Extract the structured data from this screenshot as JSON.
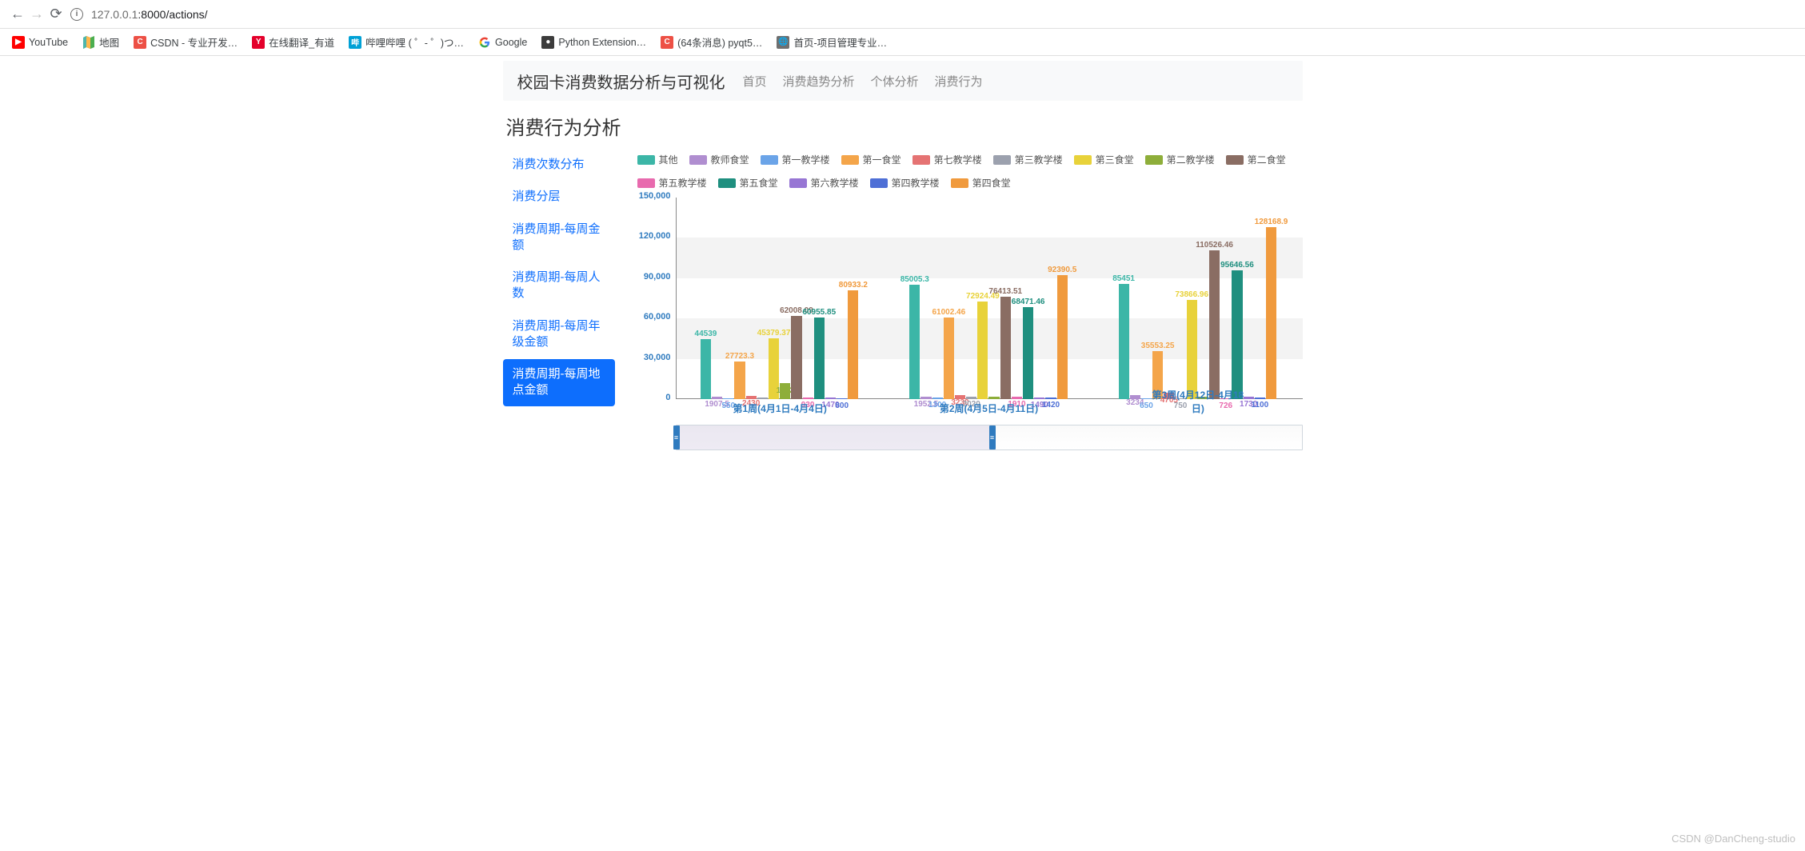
{
  "browser": {
    "url_host": "127.0.0.1",
    "url_port": ":8000",
    "url_path": "/actions/"
  },
  "bookmarks": [
    {
      "label": "YouTube",
      "bg": "#ff0000",
      "txt": "▶"
    },
    {
      "label": "地图",
      "bg": "",
      "txt": "",
      "icon": "map"
    },
    {
      "label": "CSDN - 专业开发…",
      "bg": "#ed5045",
      "txt": "C"
    },
    {
      "label": "在线翻译_有道",
      "bg": "#e4002b",
      "txt": "Y"
    },
    {
      "label": "哔哩哔哩 ( ゜- ゜)つ…",
      "bg": "#00a1d6",
      "txt": "哔"
    },
    {
      "label": "Google",
      "bg": "#ffffff",
      "txt": "G",
      "icon": "google"
    },
    {
      "label": "Python Extension…",
      "bg": "#3c3c3c",
      "txt": "●"
    },
    {
      "label": "(64条消息) pyqt5…",
      "bg": "#ed5045",
      "txt": "C"
    },
    {
      "label": "首页-项目管理专业…",
      "bg": "#6f6f6f",
      "txt": "🌐"
    }
  ],
  "header": {
    "brand": "校园卡消费数据分析与可视化",
    "nav": [
      "首页",
      "消费趋势分析",
      "个体分析",
      "消费行为"
    ]
  },
  "title": "消费行为分析",
  "sidebar": {
    "items": [
      {
        "label": "消费次数分布"
      },
      {
        "label": "消费分层"
      },
      {
        "label": "消费周期-每周金额"
      },
      {
        "label": "消费周期-每周人数"
      },
      {
        "label": "消费周期-每周年级金额"
      },
      {
        "label": "消费周期-每周地点金额",
        "active": true
      }
    ]
  },
  "watermark": "CSDN @DanCheng-studio",
  "chart_data": {
    "type": "bar",
    "title": "",
    "xlabel": "",
    "ylabel": "",
    "ylim": [
      0,
      150000
    ],
    "yticks": [
      0,
      30000,
      60000,
      90000,
      120000,
      150000
    ],
    "ytick_labels": [
      "0",
      "30,000",
      "60,000",
      "90,000",
      "120,000",
      "150,000"
    ],
    "categories": [
      "第1周(4月1日-4月4日)",
      "第2周(4月5日-4月11日)",
      "第3周(4月12日-4月18日)"
    ],
    "series": [
      {
        "name": "其他",
        "color": "#3cb6a7",
        "values": [
          44539,
          85005.3,
          85451
        ]
      },
      {
        "name": "教师食堂",
        "color": "#b08ed0",
        "values": [
          1907.5,
          1952.5,
          3234
        ]
      },
      {
        "name": "第一教学楼",
        "color": "#6ba4e8",
        "values": [
          550,
          1300,
          650
        ]
      },
      {
        "name": "第一食堂",
        "color": "#f4a54a",
        "values": [
          27723.3,
          61002.46,
          35553.25
        ]
      },
      {
        "name": "第七教学楼",
        "color": "#e57373",
        "values": [
          2430,
          3230,
          4705
        ]
      },
      {
        "name": "第三教学楼",
        "color": "#9ca1ae",
        "values": [
          1150,
          2020,
          750
        ]
      },
      {
        "name": "第三食堂",
        "color": "#e8d23a",
        "values": [
          45379.37,
          72924.49,
          73866.96
        ]
      },
      {
        "name": "第二教学楼",
        "color": "#8eae3a",
        "values": [
          12027,
          1600,
          1800
        ]
      },
      {
        "name": "第二食堂",
        "color": "#8a6d63",
        "values": [
          62008.09,
          76413.51,
          110526.46
        ]
      },
      {
        "name": "第五教学楼",
        "color": "#e86aae",
        "values": [
          930,
          1910,
          726
        ]
      },
      {
        "name": "第五食堂",
        "color": "#1f8f7f",
        "values": [
          60955.85,
          68471.46,
          95646.56
        ]
      },
      {
        "name": "第六教学楼",
        "color": "#9776d4",
        "values": [
          1470,
          1490,
          1730
        ]
      },
      {
        "name": "第四教学楼",
        "color": "#4e6fd6",
        "values": [
          800,
          1420,
          1100
        ]
      },
      {
        "name": "第四食堂",
        "color": "#f09a3d",
        "values": [
          80933.2,
          92390.5,
          128168.9
        ]
      }
    ],
    "value_labels": {
      "0": {
        "其他": "44539",
        "第一食堂": "27723.3",
        "第三食堂": "45379.37",
        "第二教学楼": "1202",
        "第二食堂": "62008.09",
        "第五食堂": "60955.85",
        "第四食堂": "80933.2",
        "教师食堂": "1907.5",
        "第一教学楼": "550",
        "第七教学楼": "2430",
        "第五教学楼": "930",
        "第六教学楼": "1470",
        "第四教学楼": "800"
      },
      "1": {
        "其他": "85005.3",
        "第一食堂": "61002.46",
        "第三食堂": "72924.49",
        "第二食堂": "76413.51",
        "第五食堂": "68471.46",
        "第四食堂": "92390.5",
        "教师食堂": "1952.5",
        "第一教学楼": "1300",
        "第七教学楼": "3230",
        "第三教学楼": "2020",
        "第五教学楼": "1910",
        "第六教学楼": "1490",
        "第四教学楼": "1420"
      },
      "2": {
        "其他": "85451",
        "第一食堂": "35553.25",
        "第三食堂": "73866.96",
        "第二食堂": "110526.46",
        "第五食堂": "95646.56",
        "第四食堂": "128168.9",
        "教师食堂": "3234",
        "第一教学楼": "650",
        "第七教学楼": "4705",
        "第三教学楼": "750",
        "第五教学楼": "726",
        "第六教学楼": "1730",
        "第四教学楼": "1100"
      }
    }
  }
}
